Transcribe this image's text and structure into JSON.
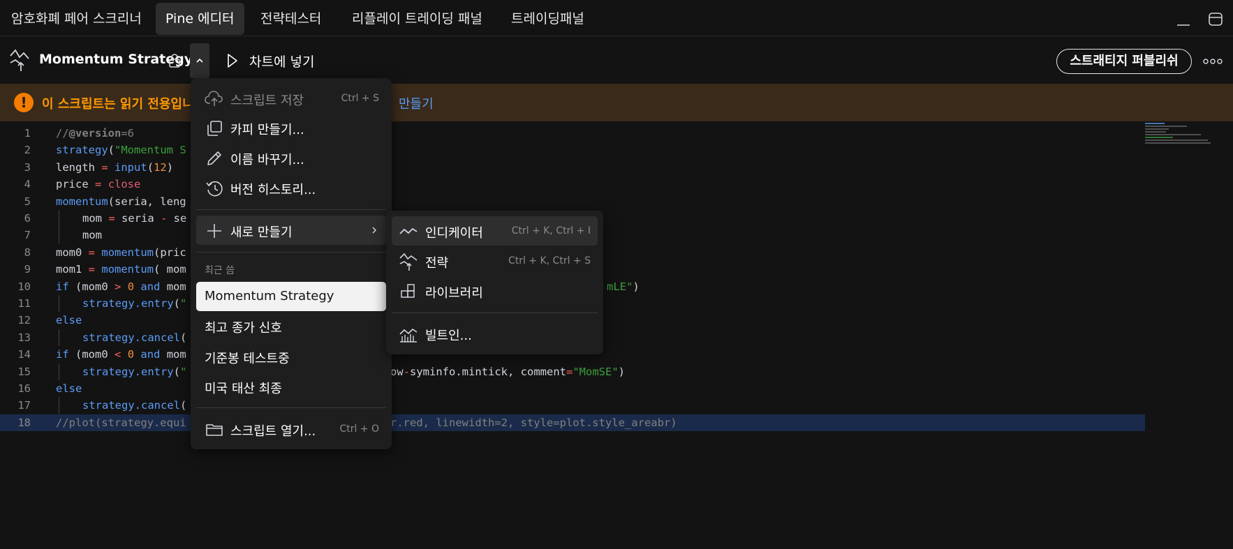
{
  "tabs": [
    {
      "label": "암호화폐 페어 스크리너"
    },
    {
      "label": "Pine 에디터",
      "active": true
    },
    {
      "label": "전략테스터"
    },
    {
      "label": "리플레이 트레이딩 패널"
    },
    {
      "label": "트레이딩패널"
    }
  ],
  "toolbar": {
    "strategy_name": "Momentum Strategy",
    "add_to_chart": "차트에 넣기",
    "publish": "스트래티지 퍼블리쉬"
  },
  "banner": {
    "text": "이 스크립트는 읽기 전용입니",
    "link": "만들기"
  },
  "editor": {
    "lines": [
      {
        "n": "1",
        "tokens": [
          [
            "com",
            "//"
          ],
          [
            "com-b",
            "@version"
          ],
          [
            "com",
            "=6"
          ]
        ]
      },
      {
        "n": "2",
        "tokens": [
          [
            "fn",
            "strategy"
          ],
          [
            "",
            "("
          ],
          [
            "str",
            "\"Momentum S"
          ]
        ]
      },
      {
        "n": "3",
        "tokens": [
          [
            "",
            "length "
          ],
          [
            "op",
            "="
          ],
          [
            "",
            " "
          ],
          [
            "fn",
            "input"
          ],
          [
            "",
            "("
          ],
          [
            "num",
            "12"
          ],
          [
            "",
            ")"
          ]
        ]
      },
      {
        "n": "4",
        "tokens": [
          [
            "",
            "price "
          ],
          [
            "op",
            "="
          ],
          [
            "",
            " "
          ],
          [
            "var",
            "close"
          ]
        ]
      },
      {
        "n": "5",
        "tokens": [
          [
            "fn",
            "momentum"
          ],
          [
            "",
            "(seria, leng"
          ]
        ]
      },
      {
        "n": "6",
        "indent": true,
        "tokens": [
          [
            "",
            "mom "
          ],
          [
            "op",
            "="
          ],
          [
            "",
            " seria "
          ],
          [
            "op",
            "-"
          ],
          [
            "",
            " se"
          ]
        ]
      },
      {
        "n": "7",
        "indent": true,
        "tokens": [
          [
            "",
            "mom"
          ]
        ]
      },
      {
        "n": "8",
        "tokens": [
          [
            "",
            "mom0 "
          ],
          [
            "op",
            "="
          ],
          [
            "",
            " "
          ],
          [
            "fn",
            "momentum"
          ],
          [
            "",
            "(pric"
          ]
        ]
      },
      {
        "n": "9",
        "tokens": [
          [
            "",
            "mom1 "
          ],
          [
            "op",
            "="
          ],
          [
            "",
            " "
          ],
          [
            "fn",
            "momentum"
          ],
          [
            "",
            "( mom"
          ]
        ]
      },
      {
        "n": "10",
        "tokens": [
          [
            "kw",
            "if"
          ],
          [
            "",
            " (mom0 "
          ],
          [
            "op",
            ">"
          ],
          [
            "",
            " "
          ],
          [
            "num",
            "0"
          ],
          [
            "",
            " "
          ],
          [
            "kw",
            "and"
          ],
          [
            "",
            " mom"
          ]
        ],
        "tail": [
          [
            "str",
            "mLE\""
          ],
          [
            "",
            ")"
          ]
        ]
      },
      {
        "n": "11",
        "indent": true,
        "tokens": [
          [
            "fn",
            "strategy.entry"
          ],
          [
            "",
            "("
          ],
          [
            "str",
            "\""
          ]
        ]
      },
      {
        "n": "12",
        "tokens": [
          [
            "kw",
            "else"
          ]
        ]
      },
      {
        "n": "13",
        "indent": true,
        "tokens": [
          [
            "fn",
            "strategy.cancel"
          ],
          [
            "",
            "("
          ]
        ]
      },
      {
        "n": "14",
        "tokens": [
          [
            "kw",
            "if"
          ],
          [
            "",
            " (mom0 "
          ],
          [
            "op",
            "<"
          ],
          [
            "",
            " "
          ],
          [
            "num",
            "0"
          ],
          [
            "",
            " "
          ],
          [
            "kw",
            "and"
          ],
          [
            "",
            " mom"
          ]
        ]
      },
      {
        "n": "15",
        "indent": true,
        "tokens": [
          [
            "fn",
            "strategy.entry"
          ],
          [
            "",
            "("
          ],
          [
            "str",
            "\""
          ]
        ],
        "tail2": [
          [
            "",
            "ow"
          ],
          [
            "op",
            "-"
          ],
          [
            "",
            "syminfo.mintick, comment"
          ],
          [
            "op",
            "="
          ],
          [
            "str",
            "\"MomSE\""
          ],
          [
            "",
            ")"
          ]
        ]
      },
      {
        "n": "16",
        "tokens": [
          [
            "kw",
            "else"
          ]
        ]
      },
      {
        "n": "17",
        "indent": true,
        "tokens": [
          [
            "fn",
            "strategy.cancel"
          ],
          [
            "",
            "("
          ]
        ]
      },
      {
        "n": "18",
        "hl": true,
        "tokens": [
          [
            "com",
            "//plot(strategy.equi"
          ]
        ],
        "tail3": [
          [
            "com",
            "r.red, linewidth=2, style=plot.style_areabr)"
          ]
        ]
      }
    ]
  },
  "menu": {
    "save": {
      "label": "스크립트 저장",
      "shortcut": "Ctrl + S"
    },
    "copy": {
      "label": "카피 만들기..."
    },
    "rename": {
      "label": "이름 바꾸기..."
    },
    "history": {
      "label": "버전 히스토리..."
    },
    "new": {
      "label": "새로 만들기"
    },
    "recent_header": "최근 씀",
    "recent": [
      "Momentum Strategy",
      "최고 종가 신호",
      "기준봉 테스트중",
      "미국 태산 최종"
    ],
    "open": {
      "label": "스크립트 열기...",
      "shortcut": "Ctrl + O"
    }
  },
  "submenu": {
    "indicator": {
      "label": "인디케이터",
      "shortcut": "Ctrl + K, Ctrl + I"
    },
    "strategy": {
      "label": "전략",
      "shortcut": "Ctrl + K, Ctrl + S"
    },
    "library": {
      "label": "라이브러리"
    },
    "builtin": {
      "label": "빌트인..."
    }
  }
}
